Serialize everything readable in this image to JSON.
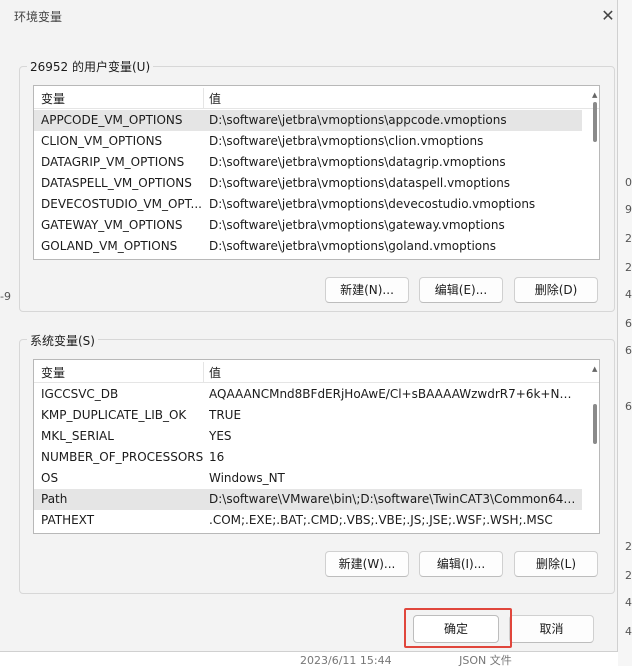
{
  "background": {
    "right_edge_fragments": [
      "0,",
      "9,",
      "2,",
      "2,",
      "4,",
      "6,",
      "6,",
      "6,",
      "2,",
      "2,",
      "4,",
      "4,"
    ],
    "left_fragment": "-9",
    "bottom_fragments": [
      "2023/6/11 15:44",
      "JSON 文件"
    ]
  },
  "dialog": {
    "title": "环境变量",
    "close_glyph": "✕"
  },
  "user_vars": {
    "group_label": "26952 的用户变量(U)",
    "col_name": "变量",
    "col_value": "值",
    "rows": [
      {
        "name": "APPCODE_VM_OPTIONS",
        "value": "D:\\software\\jetbra\\vmoptions\\appcode.vmoptions"
      },
      {
        "name": "CLION_VM_OPTIONS",
        "value": "D:\\software\\jetbra\\vmoptions\\clion.vmoptions"
      },
      {
        "name": "DATAGRIP_VM_OPTIONS",
        "value": "D:\\software\\jetbra\\vmoptions\\datagrip.vmoptions"
      },
      {
        "name": "DATASPELL_VM_OPTIONS",
        "value": "D:\\software\\jetbra\\vmoptions\\dataspell.vmoptions"
      },
      {
        "name": "DEVECOSTUDIO_VM_OPT...",
        "value": "D:\\software\\jetbra\\vmoptions\\devecostudio.vmoptions"
      },
      {
        "name": "GATEWAY_VM_OPTIONS",
        "value": "D:\\software\\jetbra\\vmoptions\\gateway.vmoptions"
      },
      {
        "name": "GOLAND_VM_OPTIONS",
        "value": "D:\\software\\jetbra\\vmoptions\\goland.vmoptions"
      }
    ],
    "new_label": "新建(N)...",
    "edit_label": "编辑(E)...",
    "delete_label": "删除(D)"
  },
  "system_vars": {
    "group_label": "系统变量(S)",
    "col_name": "变量",
    "col_value": "值",
    "rows": [
      {
        "name": "IGCCSVC_DB",
        "value": "AQAAANCMnd8BFdERjHoAwE/Cl+sBAAAAWzwdrR7+6k+NS..."
      },
      {
        "name": "KMP_DUPLICATE_LIB_OK",
        "value": "TRUE"
      },
      {
        "name": "MKL_SERIAL",
        "value": "YES"
      },
      {
        "name": "NUMBER_OF_PROCESSORS",
        "value": "16"
      },
      {
        "name": "OS",
        "value": "Windows_NT"
      },
      {
        "name": "Path",
        "value": "D:\\software\\VMware\\bin\\;D:\\software\\TwinCAT3\\Common64;..."
      },
      {
        "name": "PATHEXT",
        "value": ".COM;.EXE;.BAT;.CMD;.VBS;.VBE;.JS;.JSE;.WSF;.WSH;.MSC"
      }
    ],
    "new_label": "新建(W)...",
    "edit_label": "编辑(I)...",
    "delete_label": "删除(L)"
  },
  "footer": {
    "ok_label": "确定",
    "cancel_label": "取消"
  },
  "colors": {
    "highlight": "#e0463c",
    "selected_row": "#e5e5e5"
  }
}
